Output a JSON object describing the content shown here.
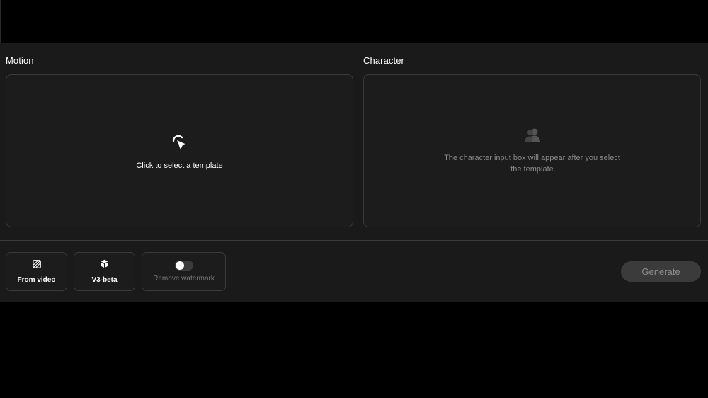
{
  "motion": {
    "label": "Motion",
    "placeholder_text": "Click to select a template",
    "icon": "pointer-click-icon"
  },
  "character": {
    "label": "Character",
    "placeholder_text": "The character input box will appear after you select the template",
    "icon": "users-icon"
  },
  "options": {
    "from_video": {
      "label": "From video",
      "icon": "striped-square-icon"
    },
    "v3_beta": {
      "label": "V3-beta",
      "icon": "cube-icon"
    },
    "remove_watermark": {
      "label": "Remove watermark",
      "enabled": false
    }
  },
  "generate": {
    "label": "Generate"
  },
  "colors": {
    "background": "#000000",
    "panel": "#1a1a1a",
    "border": "#3a3a3a",
    "button_disabled": "#3b3b3b"
  }
}
